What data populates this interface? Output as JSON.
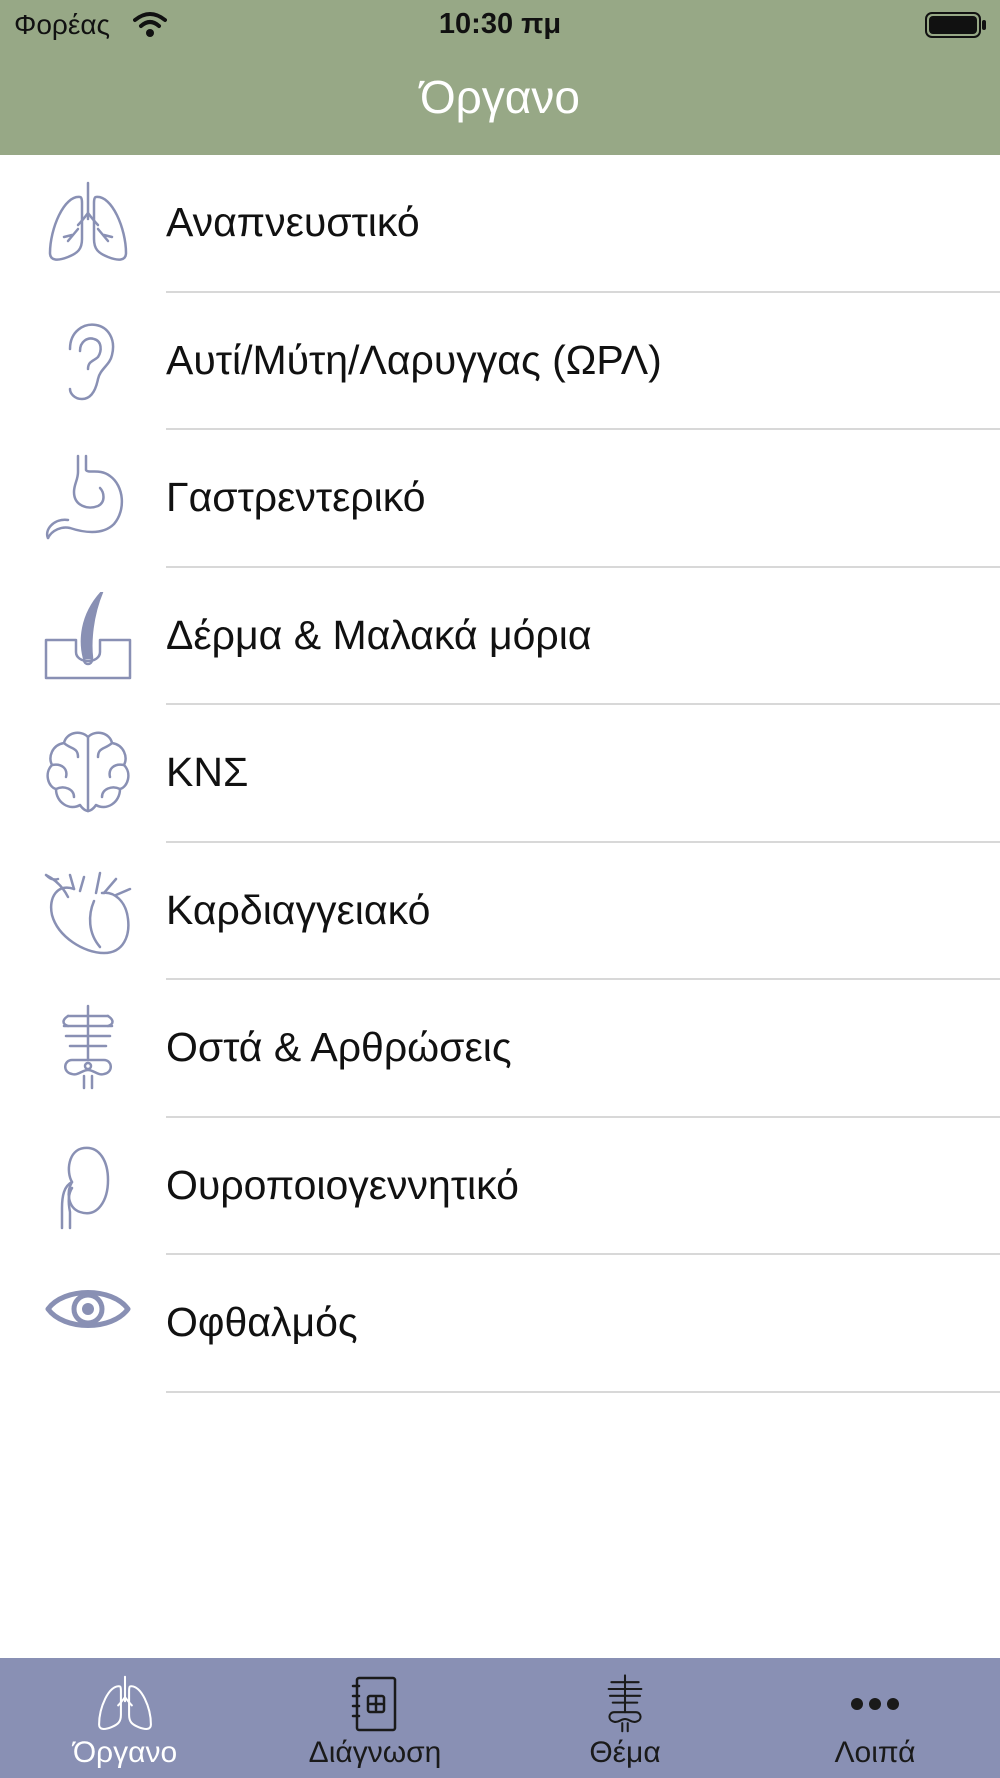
{
  "status_bar": {
    "carrier": "Φορέας",
    "time": "10:30 πμ"
  },
  "nav": {
    "title": "Όργανο"
  },
  "colors": {
    "header": "#97a886",
    "tabbar": "#8990b4",
    "icon": "#8990b4",
    "separator": "#d8d8d8"
  },
  "list": {
    "items": [
      {
        "label": "Αναπνευστικό",
        "icon": "lungs-icon"
      },
      {
        "label": "Αυτί/Μύτη/Λαρυγγας (ΩΡΛ)",
        "icon": "ear-icon"
      },
      {
        "label": "Γαστρεντερικό",
        "icon": "stomach-icon"
      },
      {
        "label": "Δέρμα & Μαλακά μόρια",
        "icon": "skin-icon"
      },
      {
        "label": "ΚΝΣ",
        "icon": "brain-icon"
      },
      {
        "label": "Καρδιαγγειακό",
        "icon": "heart-icon"
      },
      {
        "label": "Οστά & Αρθρώσεις",
        "icon": "skeleton-icon"
      },
      {
        "label": "Ουροποιογεννητικό",
        "icon": "kidney-icon"
      },
      {
        "label": "Οφθαλμός",
        "icon": "eye-icon"
      }
    ]
  },
  "tabbar": {
    "tabs": [
      {
        "label": "Όργανο",
        "icon": "lungs-icon",
        "active": true
      },
      {
        "label": "Διάγνωση",
        "icon": "medical-chart-icon",
        "active": false
      },
      {
        "label": "Θέμα",
        "icon": "skeleton-icon",
        "active": false
      },
      {
        "label": "Λοιπά",
        "icon": "more-icon",
        "active": false
      }
    ]
  }
}
